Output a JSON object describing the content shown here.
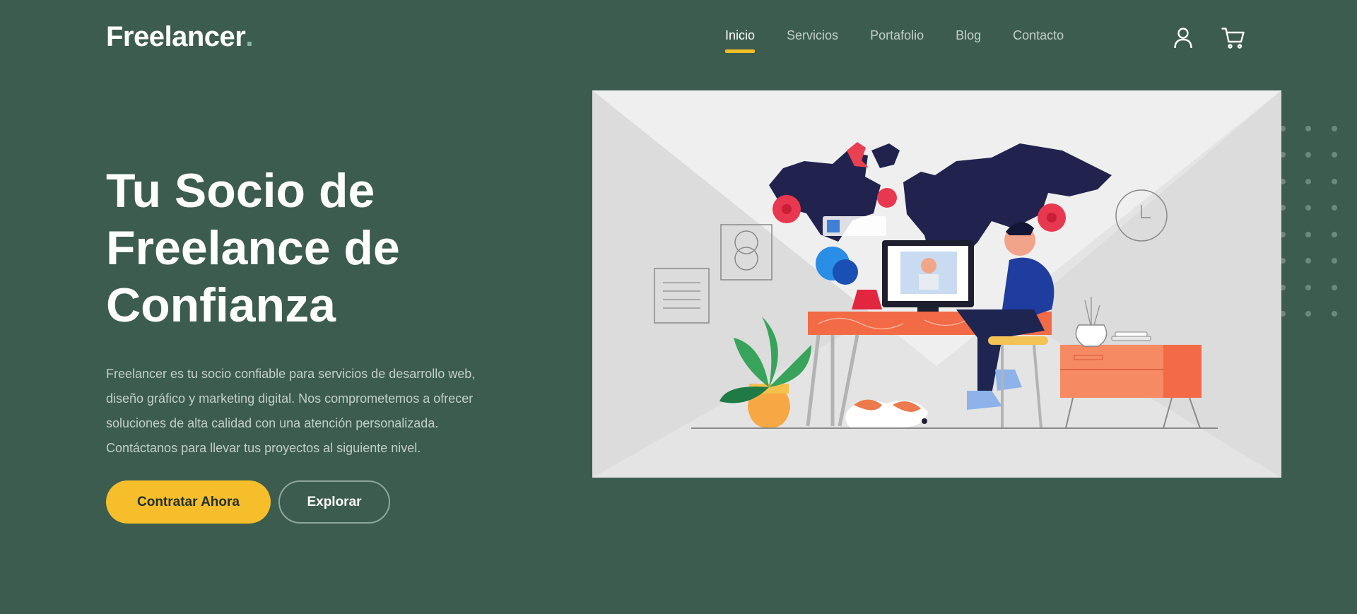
{
  "header": {
    "logo_text": "Freelancer",
    "logo_dot": ".",
    "nav": [
      {
        "label": "Inicio",
        "active": true
      },
      {
        "label": "Servicios",
        "active": false
      },
      {
        "label": "Portafolio",
        "active": false
      },
      {
        "label": "Blog",
        "active": false
      },
      {
        "label": "Contacto",
        "active": false
      }
    ],
    "icons": [
      "user-icon",
      "cart-icon"
    ]
  },
  "hero": {
    "title_lines": [
      "Tu Socio de",
      "Freelance de",
      "Confianza"
    ],
    "description_lines": [
      "Freelancer es tu socio confiable para servicios de desarrollo web,",
      "diseño gráfico y marketing digital. Nos comprometemos a ofrecer",
      "soluciones de alta calidad con una atención personalizada.",
      "Contáctanos para llevar tus proyectos al siguiente nivel."
    ],
    "primary_button": "Contratar Ahora",
    "secondary_button": "Explorar"
  },
  "colors": {
    "background": "#3c5c4f",
    "accent": "#f7be2b",
    "muted_text": "#c3cfc9"
  }
}
